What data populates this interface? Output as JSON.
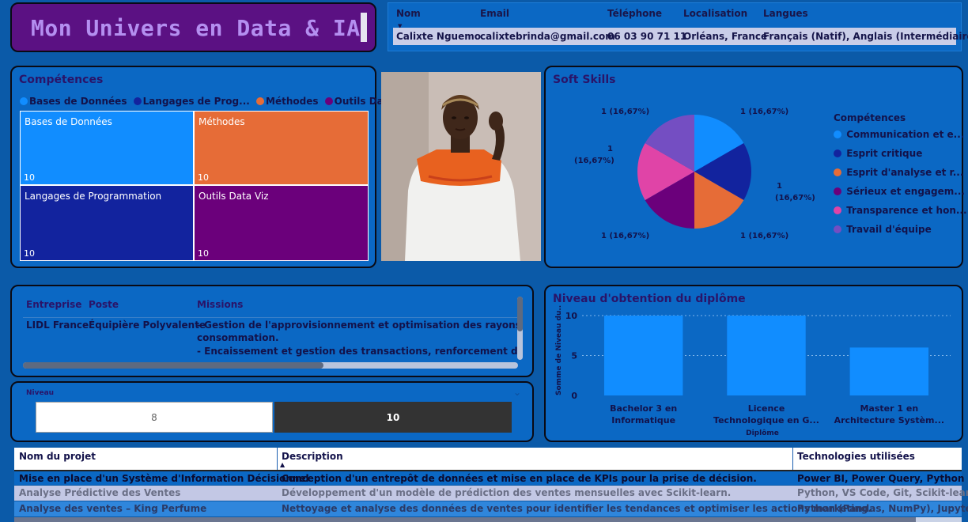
{
  "header": {
    "title": "Mon Univers en Data & IA"
  },
  "contact": {
    "columns": [
      "Nom",
      "Email",
      "Téléphone",
      "Localisation",
      "Langues"
    ],
    "row": [
      "Calixte Nguemo",
      "calixtebrinda@gmail.com",
      "06 03 90 71 11",
      "Orléans, France",
      "Français (Natif), Anglais (Intermédiaire)"
    ]
  },
  "competences": {
    "title": "Compétences",
    "legend": [
      {
        "label": "Bases de Données",
        "color": "#118dff"
      },
      {
        "label": "Langages de Prog...",
        "color": "#12239e"
      },
      {
        "label": "Méthodes",
        "color": "#e66c37"
      },
      {
        "label": "Outils Data Viz",
        "color": "#6b007b"
      }
    ],
    "tiles": [
      {
        "label": "Bases de Données",
        "value": "10",
        "color": "#118dff"
      },
      {
        "label": "Méthodes",
        "value": "10",
        "color": "#e66c37"
      },
      {
        "label": "Langages de Programmation",
        "value": "10",
        "color": "#12239e"
      },
      {
        "label": "Outils Data Viz",
        "value": "10",
        "color": "#6b007b"
      }
    ]
  },
  "soft_skills": {
    "title": "Soft Skills",
    "legend_title": "Compétences",
    "slice_labels": [
      "1 (16,67%)",
      "1 (16,67%)",
      "1",
      "(16,67%)",
      "1 (16,67%)",
      "1 (16,67%)",
      "1",
      "(16,67%)"
    ],
    "legend": [
      {
        "label": "Communication et e...",
        "color": "#118dff"
      },
      {
        "label": "Esprit critique",
        "color": "#12239e"
      },
      {
        "label": "Esprit d'analyse et r...",
        "color": "#e66c37"
      },
      {
        "label": "Sérieux et engagem...",
        "color": "#6b007b"
      },
      {
        "label": "Transparence et hon...",
        "color": "#e044a7"
      },
      {
        "label": "Travail d'équipe",
        "color": "#744ec2"
      }
    ]
  },
  "experience": {
    "columns": [
      "Entreprise",
      "Poste",
      "Missions"
    ],
    "entreprise": "LIDL France",
    "poste": "Équipière Polyvalente",
    "missions": [
      "- Gestion de l'approvisionnement et optimisation des rayons, analyse",
      "consommation.",
      "- Encaissement et gestion des transactions, renforcement de la précis"
    ]
  },
  "niveau": {
    "label": "Niveau",
    "options": [
      "8",
      "10"
    ]
  },
  "diplome": {
    "title": "Niveau d'obtention du diplôme",
    "chart_data": {
      "type": "bar",
      "title": "Niveau d'obtention du diplôme",
      "categories": [
        "Bachelor 3 en Informatique",
        "Licence Technologique en G...",
        "Master 1 en Architecture Systèm..."
      ],
      "category_lines": [
        [
          "Bachelor 3 en",
          "Informatique"
        ],
        [
          "Licence",
          "Technologique en G..."
        ],
        [
          "Master 1 en",
          "Architecture Systèm..."
        ]
      ],
      "values": [
        10,
        10,
        6
      ],
      "ylabel": "Somme de Niveau du...",
      "xlabel": "Diplôme",
      "yticks": [
        "10",
        "5",
        "0"
      ],
      "ylim": [
        0,
        10
      ],
      "color": "#118dff"
    }
  },
  "projects": {
    "columns": [
      "Nom du projet",
      "Description",
      "Technologies utilisées"
    ],
    "rows": [
      [
        "Mise en place d'un Système d'Information Décisionnel",
        "Conception d'un entrepôt de données et mise en place de KPIs pour la prise de décision.",
        "Power BI, Power Query, Python"
      ],
      [
        "Analyse Prédictive des Ventes",
        "Développement d'un modèle de prédiction des ventes mensuelles avec Scikit-learn.",
        "Python, VS Code, Git, Scikit-learn"
      ],
      [
        "Analyse des ventes – King Perfume",
        "Nettoyage et analyse des données de ventes pour identifier les tendances et optimiser les actions marketing.",
        "Python (Pandas, NumPy), Jupyter N"
      ]
    ]
  }
}
